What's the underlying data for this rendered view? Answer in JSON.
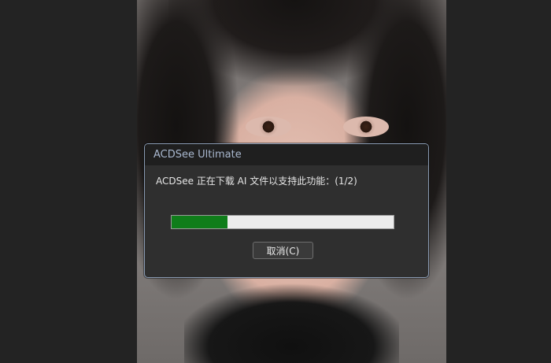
{
  "dialog": {
    "title": "ACDSee Ultimate",
    "message": "ACDSee 正在下载 AI 文件以支持此功能：(1/2)",
    "progress": 0.25,
    "progress_color": "#0f7d1a",
    "cancel_label": "取消(C)"
  },
  "colors": {
    "background": "#232323",
    "dialog_bg": "#2f2f2f",
    "titlebar_bg": "#1f1f1f",
    "title_text": "#a9b8cf",
    "dialog_border": "#8a9bb3"
  }
}
